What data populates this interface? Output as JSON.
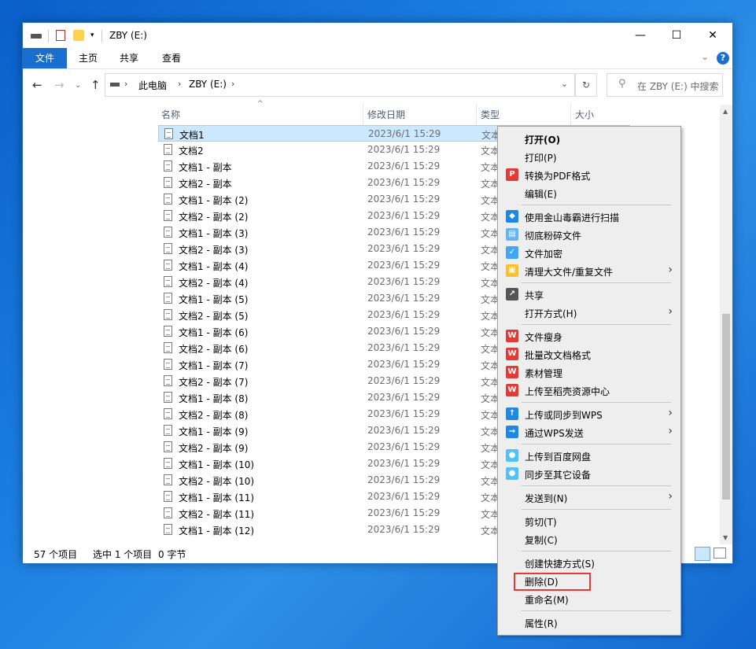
{
  "window": {
    "title": "ZBY (E:)",
    "minimize": "—",
    "maximize": "☐",
    "close": "✕"
  },
  "ribbon": {
    "tabs": [
      "文件",
      "主页",
      "共享",
      "查看"
    ]
  },
  "address": {
    "crumbs": [
      "此电脑",
      "ZBY (E:)"
    ],
    "search_placeholder": "在 ZBY (E:) 中搜索"
  },
  "columns": [
    "名称",
    "修改日期",
    "类型",
    "大小"
  ],
  "files": [
    {
      "name": "文档1",
      "date": "2023/6/1 15:29",
      "type": "文本"
    },
    {
      "name": "文档2",
      "date": "2023/6/1 15:29",
      "type": "文本"
    },
    {
      "name": "文档1 - 副本",
      "date": "2023/6/1 15:29",
      "type": "文本"
    },
    {
      "name": "文档2 - 副本",
      "date": "2023/6/1 15:29",
      "type": "文本"
    },
    {
      "name": "文档1 - 副本 (2)",
      "date": "2023/6/1 15:29",
      "type": "文本"
    },
    {
      "name": "文档2 - 副本 (2)",
      "date": "2023/6/1 15:29",
      "type": "文本"
    },
    {
      "name": "文档1 - 副本 (3)",
      "date": "2023/6/1 15:29",
      "type": "文本"
    },
    {
      "name": "文档2 - 副本 (3)",
      "date": "2023/6/1 15:29",
      "type": "文本"
    },
    {
      "name": "文档1 - 副本 (4)",
      "date": "2023/6/1 15:29",
      "type": "文本"
    },
    {
      "name": "文档2 - 副本 (4)",
      "date": "2023/6/1 15:29",
      "type": "文本"
    },
    {
      "name": "文档1 - 副本 (5)",
      "date": "2023/6/1 15:29",
      "type": "文本"
    },
    {
      "name": "文档2 - 副本 (5)",
      "date": "2023/6/1 15:29",
      "type": "文本"
    },
    {
      "name": "文档1 - 副本 (6)",
      "date": "2023/6/1 15:29",
      "type": "文本"
    },
    {
      "name": "文档2 - 副本 (6)",
      "date": "2023/6/1 15:29",
      "type": "文本"
    },
    {
      "name": "文档1 - 副本 (7)",
      "date": "2023/6/1 15:29",
      "type": "文本"
    },
    {
      "name": "文档2 - 副本 (7)",
      "date": "2023/6/1 15:29",
      "type": "文本"
    },
    {
      "name": "文档1 - 副本 (8)",
      "date": "2023/6/1 15:29",
      "type": "文本"
    },
    {
      "name": "文档2 - 副本 (8)",
      "date": "2023/6/1 15:29",
      "type": "文本"
    },
    {
      "name": "文档1 - 副本 (9)",
      "date": "2023/6/1 15:29",
      "type": "文本"
    },
    {
      "name": "文档2 - 副本 (9)",
      "date": "2023/6/1 15:29",
      "type": "文本"
    },
    {
      "name": "文档1 - 副本 (10)",
      "date": "2023/6/1 15:29",
      "type": "文本"
    },
    {
      "name": "文档2 - 副本 (10)",
      "date": "2023/6/1 15:29",
      "type": "文本"
    },
    {
      "name": "文档1 - 副本 (11)",
      "date": "2023/6/1 15:29",
      "type": "文本"
    },
    {
      "name": "文档2 - 副本 (11)",
      "date": "2023/6/1 15:29",
      "type": "文本"
    },
    {
      "name": "文档1 - 副本 (12)",
      "date": "2023/6/1 15:29",
      "type": "文本"
    }
  ],
  "status": {
    "count": "57 个项目",
    "selected": "选中 1 个项目",
    "size": "0 字节"
  },
  "context_menu": [
    {
      "label": "打开(O)",
      "bold": true
    },
    {
      "label": "打印(P)"
    },
    {
      "label": "转换为PDF格式",
      "icon": "pdf-icon",
      "color": "#e53935",
      "glyph": "P"
    },
    {
      "label": "编辑(E)"
    },
    {
      "sep": true
    },
    {
      "label": "使用金山毒霸进行扫描",
      "icon": "duba-icon",
      "color": "#1e88e5",
      "glyph": "◆"
    },
    {
      "label": "彻底粉碎文件",
      "icon": "shredder-icon",
      "color": "#64b5f6",
      "glyph": "▤"
    },
    {
      "label": "文件加密",
      "icon": "lock-shield-icon",
      "color": "#42a5f5",
      "glyph": "✓"
    },
    {
      "label": "清理大文件/重复文件",
      "icon": "cleanup-icon",
      "color": "#fbc02d",
      "glyph": "▣",
      "sub": true
    },
    {
      "sep": true
    },
    {
      "label": "共享",
      "icon": "share-icon",
      "color": "#555555",
      "glyph": "↗"
    },
    {
      "label": "打开方式(H)",
      "sub": true
    },
    {
      "sep": true
    },
    {
      "label": "文件瘦身",
      "icon": "wps-icon",
      "color": "#e53935",
      "glyph": "W"
    },
    {
      "label": "批量改文档格式",
      "icon": "wps-icon",
      "color": "#e53935",
      "glyph": "W"
    },
    {
      "label": "素材管理",
      "icon": "wps-icon",
      "color": "#e53935",
      "glyph": "W"
    },
    {
      "label": "上传至稻壳资源中心",
      "icon": "wps-icon",
      "color": "#e53935",
      "glyph": "W"
    },
    {
      "sep": true
    },
    {
      "label": "上传或同步到WPS",
      "icon": "cloud-upload-icon",
      "color": "#1e88e5",
      "glyph": "↑",
      "sub": true
    },
    {
      "label": "通过WPS发送",
      "icon": "send-icon",
      "color": "#1e88e5",
      "glyph": "→",
      "sub": true
    },
    {
      "sep": true
    },
    {
      "label": "上传到百度网盘",
      "icon": "baidu-icon",
      "color": "#4fc3f7",
      "glyph": "●"
    },
    {
      "label": "同步至其它设备",
      "icon": "baidu-icon",
      "color": "#4fc3f7",
      "glyph": "●"
    },
    {
      "sep": true
    },
    {
      "label": "发送到(N)",
      "sub": true
    },
    {
      "sep": true
    },
    {
      "label": "剪切(T)"
    },
    {
      "label": "复制(C)"
    },
    {
      "sep": true
    },
    {
      "label": "创建快捷方式(S)"
    },
    {
      "label": "删除(D)",
      "highlight": true
    },
    {
      "label": "重命名(M)"
    },
    {
      "sep": true
    },
    {
      "label": "属性(R)"
    }
  ]
}
